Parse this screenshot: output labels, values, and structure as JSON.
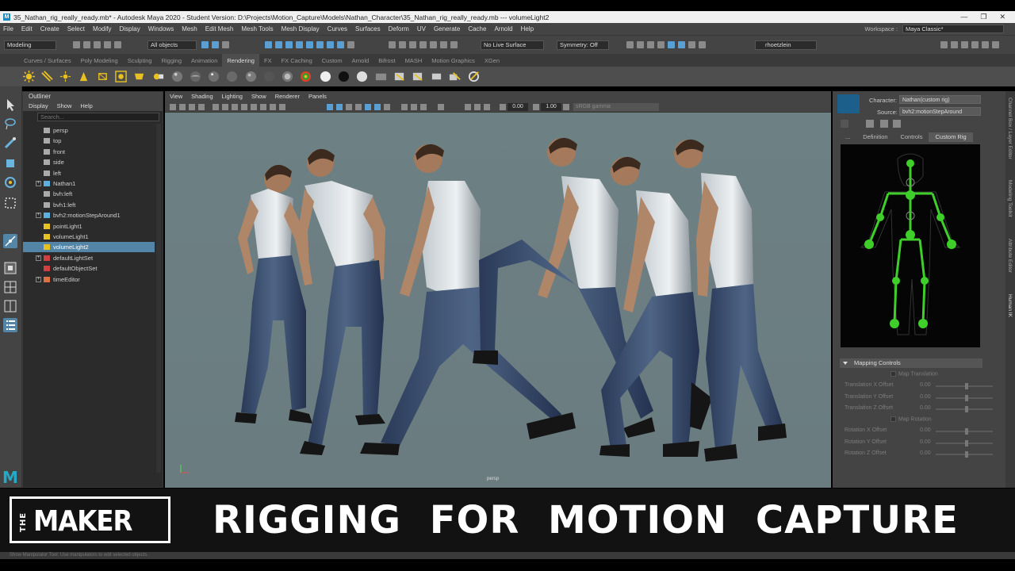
{
  "window": {
    "title": "35_Nathan_rig_really_ready.mb* - Autodesk Maya 2020 - Student Version: D:\\Projects\\Motion_Capture\\Models\\Nathan_Character\\35_Nathan_rig_really_ready.mb  ---  volumeLight2",
    "controls": [
      "—",
      "❐",
      "✕"
    ]
  },
  "menubar": {
    "items": [
      "File",
      "Edit",
      "Create",
      "Select",
      "Modify",
      "Display",
      "Windows",
      "Mesh",
      "Edit Mesh",
      "Mesh Tools",
      "Mesh Display",
      "Curves",
      "Surfaces",
      "Deform",
      "UV",
      "Generate",
      "Cache",
      "Arnold",
      "Help"
    ],
    "workspace_label": "Workspace :",
    "workspace_value": "Maya Classic*"
  },
  "statusline": {
    "mode": "Modeling",
    "objects": "All objects",
    "live_surface": "No Live Surface",
    "symmetry": "Symmetry: Off",
    "user": "rhoetzlein"
  },
  "shelf": {
    "tabs": [
      "Curves / Surfaces",
      "Poly Modeling",
      "Sculpting",
      "Rigging",
      "Animation",
      "Rendering",
      "FX",
      "FX Caching",
      "Custom",
      "Arnold",
      "Bifrost",
      "MASH",
      "Motion Graphics",
      "XGen"
    ],
    "active_tab": "Rendering"
  },
  "outliner": {
    "title": "Outliner",
    "menu": [
      "Display",
      "Show",
      "Help"
    ],
    "search_placeholder": "Search...",
    "items": [
      {
        "label": "persp",
        "icon": "camera-icon",
        "expandable": false,
        "selected": false
      },
      {
        "label": "top",
        "icon": "camera-icon",
        "expandable": false,
        "selected": false
      },
      {
        "label": "front",
        "icon": "camera-icon",
        "expandable": false,
        "selected": false
      },
      {
        "label": "side",
        "icon": "camera-icon",
        "expandable": false,
        "selected": false
      },
      {
        "label": "left",
        "icon": "camera-icon",
        "expandable": false,
        "selected": false
      },
      {
        "label": "Nathan1",
        "icon": "joint-icon",
        "expandable": true,
        "selected": false
      },
      {
        "label": "bvh:left",
        "icon": "camera-icon",
        "expandable": false,
        "selected": false
      },
      {
        "label": "bvh1:left",
        "icon": "camera-icon",
        "expandable": false,
        "selected": false
      },
      {
        "label": "bvh2:motionStepAround1",
        "icon": "joint-icon",
        "expandable": true,
        "selected": false
      },
      {
        "label": "pointLight1",
        "icon": "light-icon",
        "expandable": false,
        "selected": false
      },
      {
        "label": "volumeLight1",
        "icon": "volume-light-icon",
        "expandable": false,
        "selected": false
      },
      {
        "label": "volumeLight2",
        "icon": "volume-light-icon",
        "expandable": false,
        "selected": true
      },
      {
        "label": "defaultLightSet",
        "icon": "set-icon",
        "expandable": true,
        "selected": false
      },
      {
        "label": "defaultObjectSet",
        "icon": "set-icon",
        "expandable": false,
        "selected": false
      },
      {
        "label": "timeEditor",
        "icon": "time-editor-icon",
        "expandable": true,
        "selected": false
      }
    ]
  },
  "viewport": {
    "menu": [
      "View",
      "Shading",
      "Lighting",
      "Show",
      "Renderer",
      "Panels"
    ],
    "value_a": "0.00",
    "value_b": "1.00",
    "gamma": "sRGB gamma",
    "camera_label": "persp"
  },
  "humanik": {
    "character_label": "Character:",
    "character_value": "Nathan(custom rig)",
    "source_label": "Source:",
    "source_value": "bvh2:motionStepAround",
    "tabs": [
      "...",
      "Definition",
      "Controls",
      "Custom Rig"
    ],
    "active_tab": "Custom Rig",
    "mapping": {
      "header": "Mapping Controls",
      "map_translation": "Map Translation",
      "translation_rows": [
        {
          "label": "Translation X Offset",
          "value": "0.00"
        },
        {
          "label": "Translation Y Offset",
          "value": "0.00"
        },
        {
          "label": "Translation Z Offset",
          "value": "0.00"
        }
      ],
      "map_rotation": "Map Rotation",
      "rotation_rows": [
        {
          "label": "Rotation X Offset",
          "value": "0.00"
        },
        {
          "label": "Rotation Y Offset",
          "value": "0.00"
        },
        {
          "label": "Rotation Z Offset",
          "value": "0.00"
        }
      ]
    }
  },
  "side_tabs": [
    "Channel Box / Layer Editor",
    "Modeling Toolkit",
    "Attribute Editor",
    "Human IK"
  ],
  "helpline": "Show Manipulator Tool: Use manipulators to edit selected objects.",
  "banner": {
    "logo_small": "THE",
    "logo_word": "MAKER",
    "title": "RIGGING FOR MOTION CAPTURE"
  },
  "colors": {
    "viewport_bg": "#6e8286",
    "selection": "#5285a6",
    "hik_green": "#3fcf2a"
  }
}
